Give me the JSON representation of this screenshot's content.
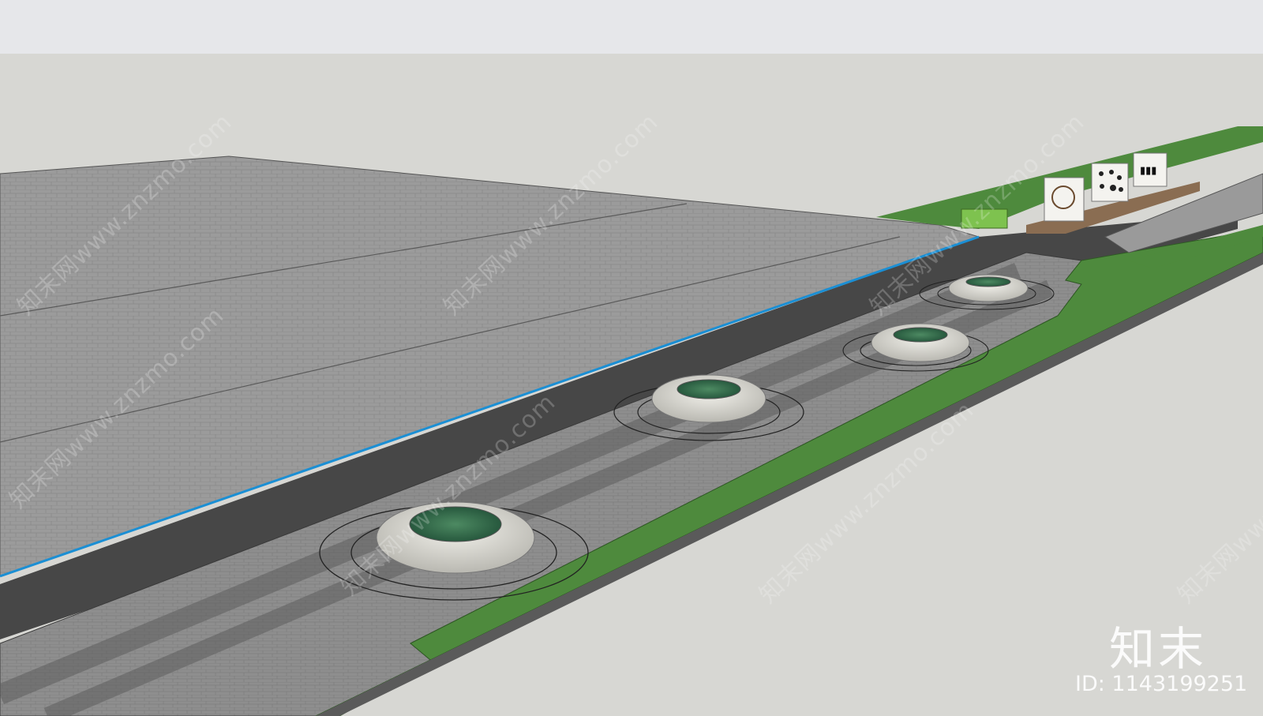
{
  "scene": {
    "sky_color": "#d7d7d3",
    "top_bar_color": "#e6e7ea",
    "plaza_color": "#9a9a9a",
    "road_color": "#4a4a4a",
    "grass_color": "#4e8a3d",
    "edge_line_color": "#1b8fd4",
    "planter_count": 4,
    "feature_walls": 3
  },
  "watermark": {
    "text": "知末网www.znzmo.com",
    "logo": "知末",
    "id_line": "ID: 1143199251"
  }
}
